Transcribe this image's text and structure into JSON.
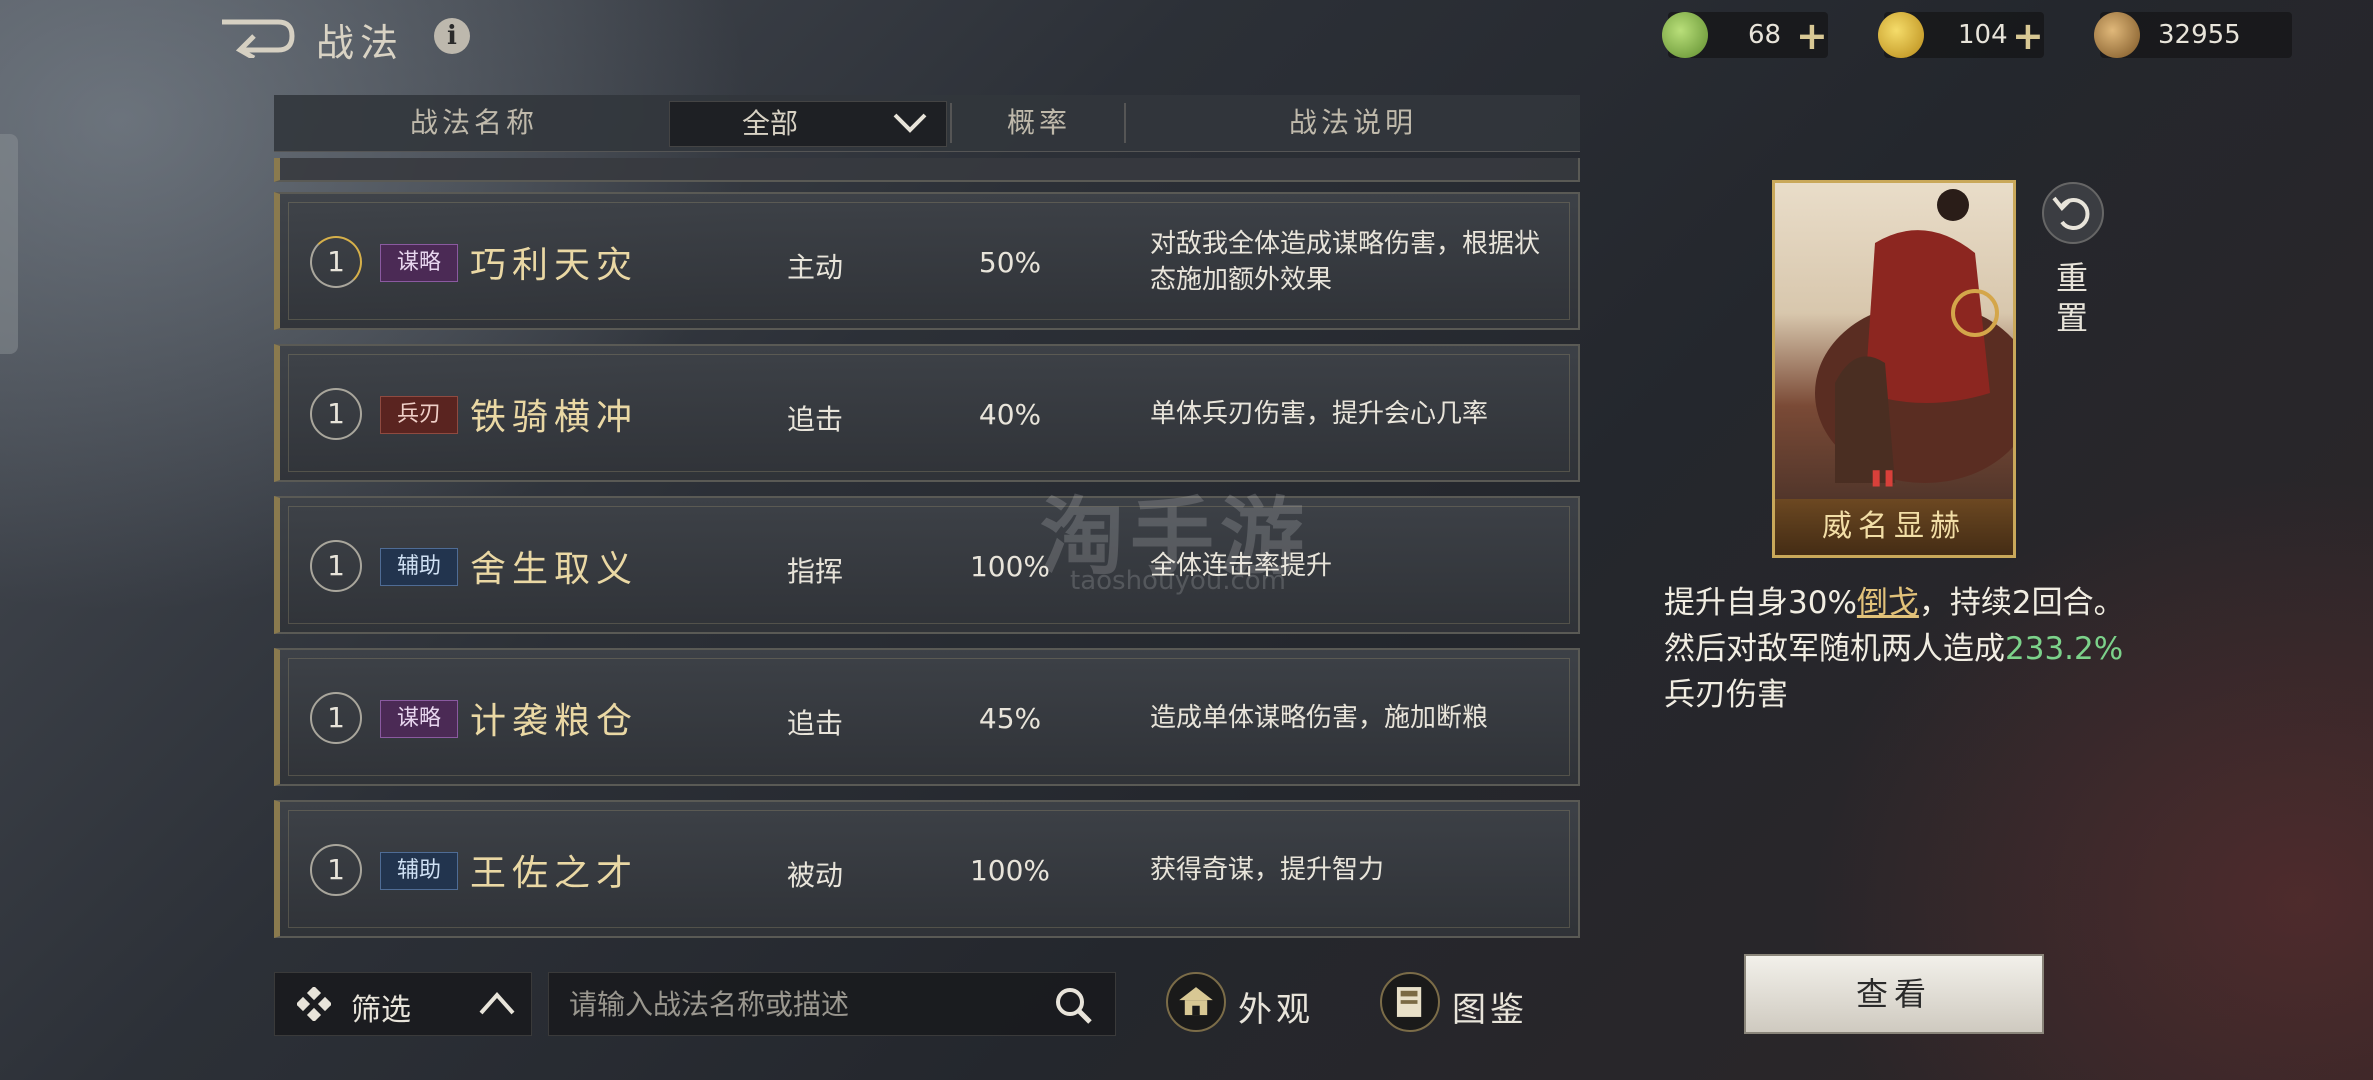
{
  "header": {
    "title": "战法"
  },
  "resources": [
    {
      "icon": "jade-coin-icon",
      "value": "68",
      "color": "#7fae4a"
    },
    {
      "icon": "gold-coin-icon",
      "value": "104",
      "color": "#d8b238"
    },
    {
      "icon": "copper-coin-icon",
      "value": "32955",
      "color": "#b58a4a"
    }
  ],
  "table": {
    "col_name": "战法名称",
    "filter_value": "全部",
    "col_rate": "概率",
    "col_desc": "战法说明"
  },
  "rows": [
    {
      "level": "1",
      "tag": "谋略",
      "name": "巧利天灾",
      "type": "主动",
      "rate": "50%",
      "desc": "对敌我全体造成谋略伤害，根据状态施加额外效果"
    },
    {
      "level": "1",
      "tag": "兵刃",
      "name": "铁骑横冲",
      "type": "追击",
      "rate": "40%",
      "desc": "单体兵刃伤害，提升会心几率"
    },
    {
      "level": "1",
      "tag": "辅助",
      "name": "舍生取义",
      "type": "指挥",
      "rate": "100%",
      "desc": "全体连击率提升"
    },
    {
      "level": "1",
      "tag": "谋略",
      "name": "计袭粮仓",
      "type": "追击",
      "rate": "45%",
      "desc": "造成单体谋略伤害，施加断粮"
    },
    {
      "level": "1",
      "tag": "辅助",
      "name": "王佐之才",
      "type": "被动",
      "rate": "100%",
      "desc": "获得奇谋，提升智力"
    }
  ],
  "bottom": {
    "filter_label": "筛选",
    "search_placeholder": "请输入战法名称或描述",
    "appearance_label": "外观",
    "catalog_label": "图鉴"
  },
  "detail": {
    "card_name": "威名显赫",
    "reset_label": "重置",
    "desc_pre": "提升自身30%",
    "desc_kw": "倒戈",
    "desc_mid": "，持续2回合。然后对敌军随机两人造成",
    "desc_num": "233.2%",
    "desc_post": "兵刃伤害",
    "view_button": "查看"
  },
  "watermark": {
    "main": "淘手游",
    "sub": "taoshouyou.com"
  }
}
